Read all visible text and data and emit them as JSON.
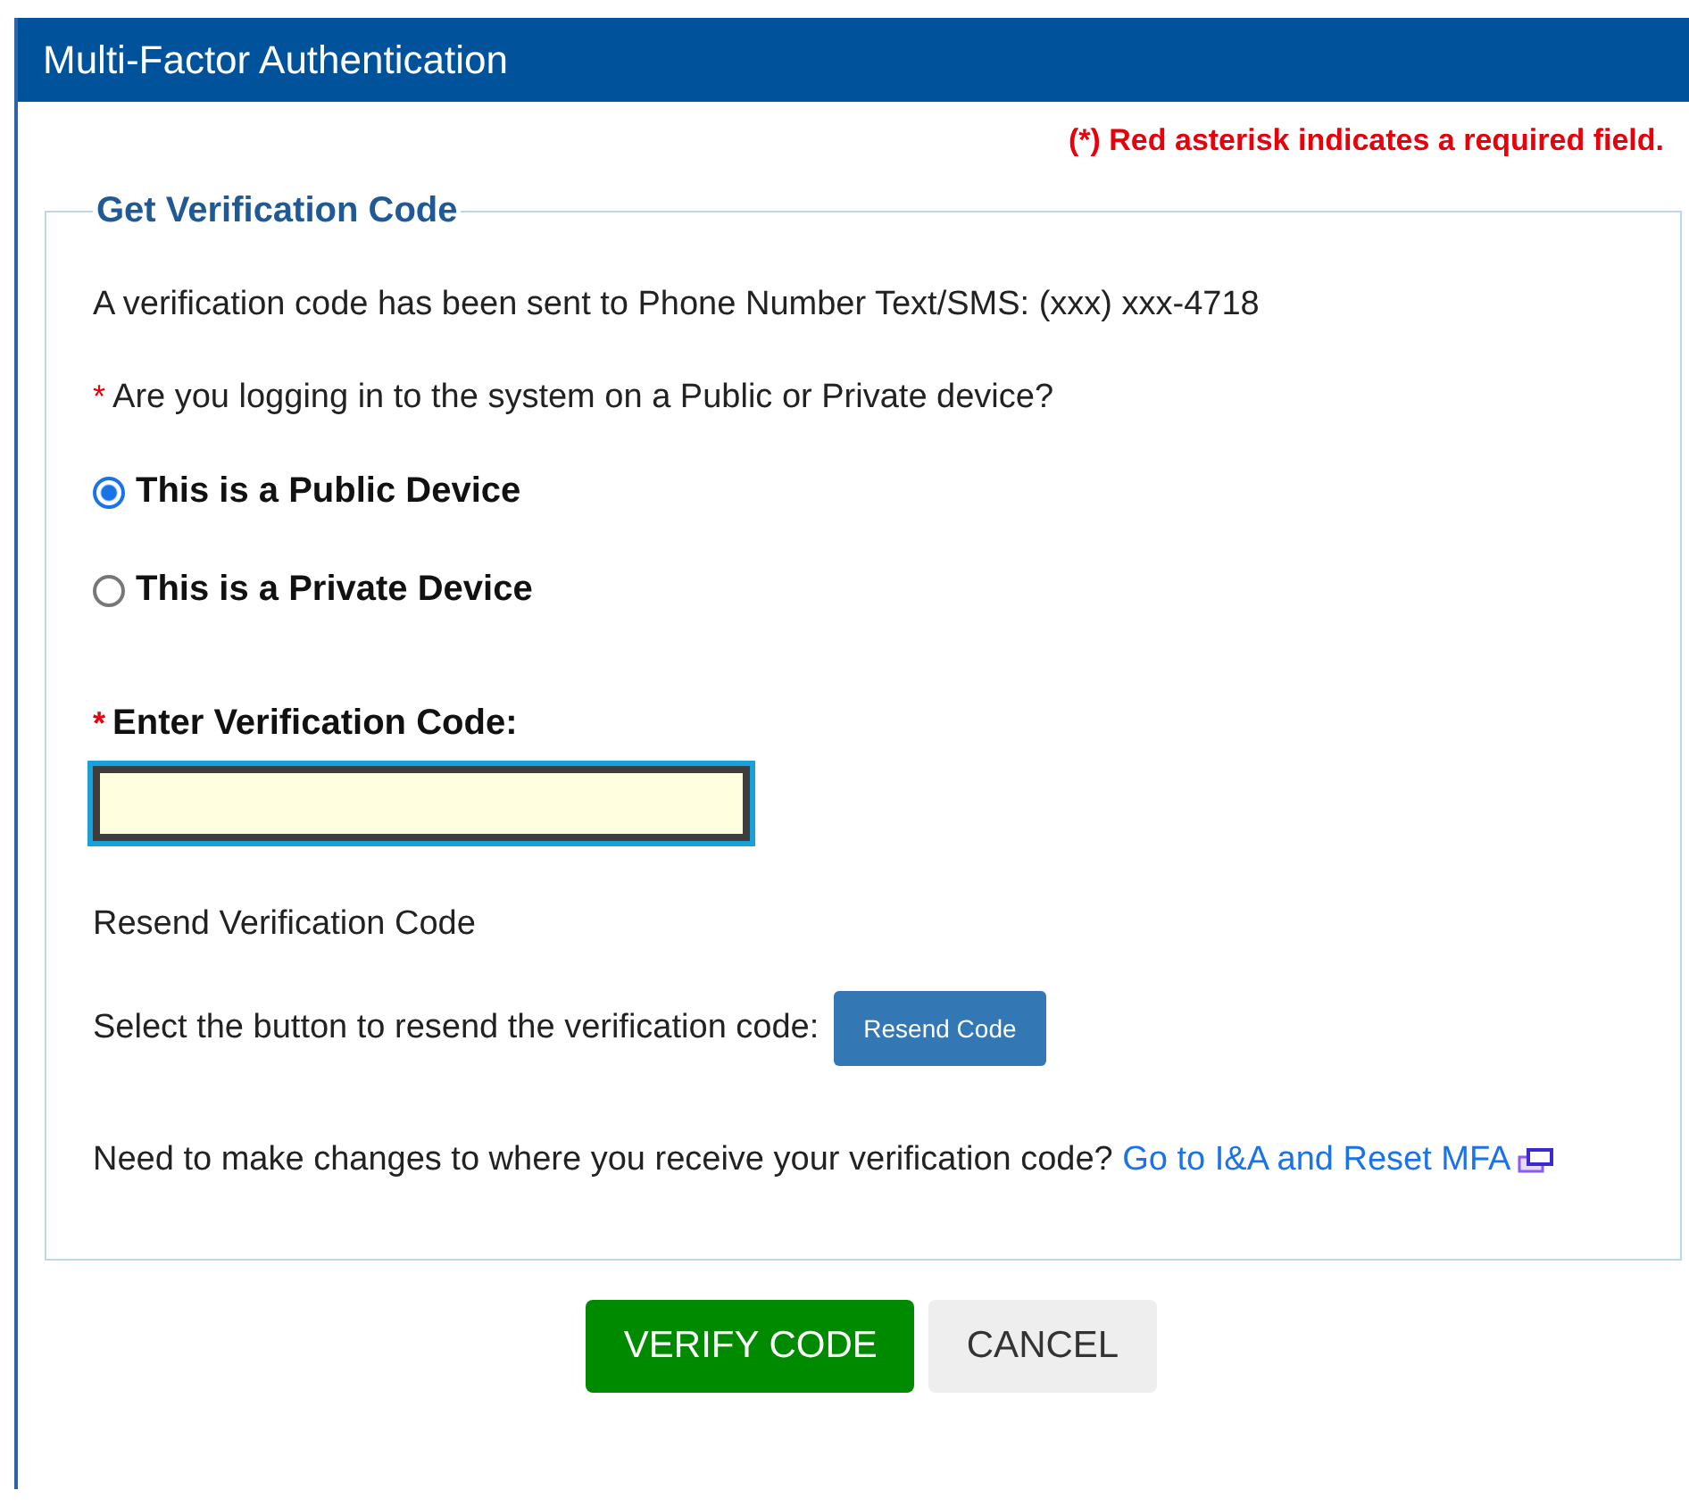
{
  "window": {
    "title": "Multi-Factor Authentication"
  },
  "required_note": "(*) Red asterisk indicates a required field.",
  "section": {
    "legend": "Get Verification Code",
    "sent_message": "A verification code has been sent to Phone Number Text/SMS: (xxx) xxx-4718",
    "device_question": {
      "required_mark": "*",
      "text": "Are you logging in to the system on a Public or Private device?"
    },
    "device_options": [
      {
        "label": "This is a Public Device",
        "selected": true
      },
      {
        "label": "This is a Private Device",
        "selected": false
      }
    ],
    "code_field": {
      "required_mark": "*",
      "label": "Enter Verification Code:"
    },
    "resend_heading": "Resend Verification Code",
    "resend_prompt": "Select the button to resend the verification code:",
    "resend_button": "Resend Code",
    "changes_text": "Need to make changes to where you receive your verification code?",
    "changes_link": "Go to I&A and Reset MFA"
  },
  "buttons": [
    {
      "label": "VERIFY CODE",
      "kind": "primary"
    },
    {
      "label": "CANCEL",
      "kind": "secondary"
    }
  ]
}
